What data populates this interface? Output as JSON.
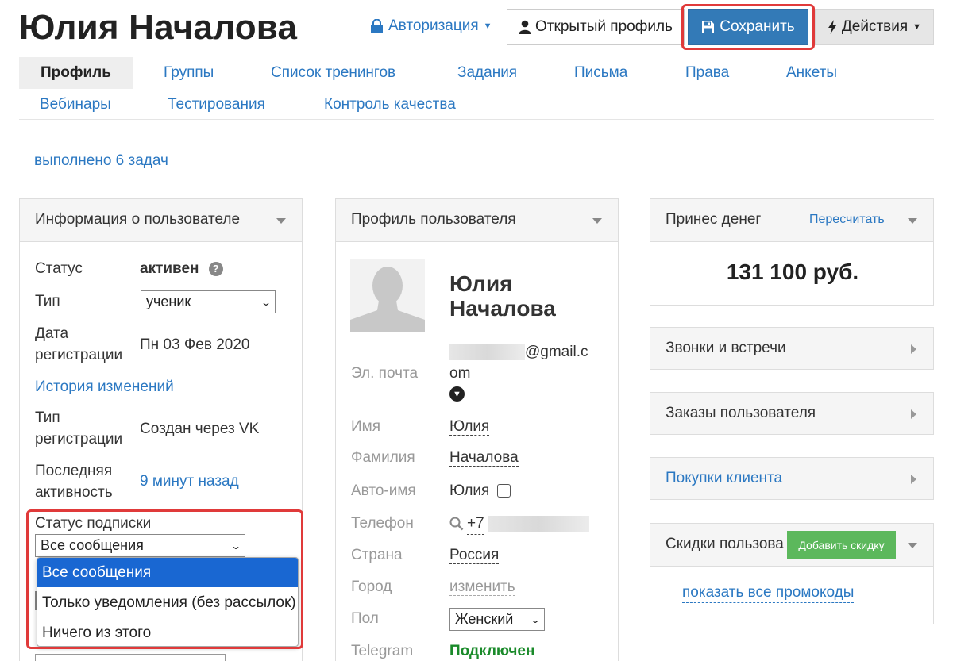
{
  "header": {
    "title": "Юлия Началова",
    "auth_label": "Авторизация",
    "open_profile_label": "Открытый профиль",
    "save_label": "Сохранить",
    "actions_label": "Действия"
  },
  "tabs": [
    {
      "label": "Профиль",
      "active": true
    },
    {
      "label": "Группы"
    },
    {
      "label": "Список тренингов"
    },
    {
      "label": "Задания"
    },
    {
      "label": "Письма"
    },
    {
      "label": "Права"
    },
    {
      "label": "Анкеты"
    },
    {
      "label": "Вебинары"
    },
    {
      "label": "Тестирования"
    },
    {
      "label": "Контроль качества"
    }
  ],
  "tasks_link": "выполнено 6 задач",
  "user_info": {
    "title": "Информация о пользователе",
    "status_label": "Статус",
    "status_value": "активен",
    "type_label": "Тип",
    "type_value": "ученик",
    "reg_date_label_1": "Дата",
    "reg_date_label_2": "регистрации",
    "reg_date_value": "Пн 03 Фев 2020",
    "history_link": "История изменений",
    "reg_type_label_1": "Тип",
    "reg_type_label_2": "регистрации",
    "reg_type_value": "Создан через VK",
    "last_activity_label_1": "Последняя",
    "last_activity_label_2": "активность",
    "last_activity_value": "9 минут назад",
    "subscription_label": "Статус подписки",
    "subscription_value": "Все сообщения",
    "subscription_options": [
      "Все сообщения",
      "Только уведомления (без рассылок)",
      "Ничего из этого"
    ]
  },
  "profile": {
    "title": "Профиль пользователя",
    "name_line1": "Юлия",
    "name_line2": "Началова",
    "email_visible_1": "@gmail.c",
    "email_visible_2": "om",
    "email_label": "Эл. почта",
    "first_name_label": "Имя",
    "first_name_value": "Юлия",
    "last_name_label": "Фамилия",
    "last_name_value": "Началова",
    "auto_name_label": "Авто-имя",
    "auto_name_value": "Юлия",
    "phone_label": "Телефон",
    "phone_prefix": "+7",
    "country_label": "Страна",
    "country_value": "Россия",
    "city_label": "Город",
    "city_value": "изменить",
    "gender_label": "Пол",
    "gender_value": "Женский",
    "telegram_label": "Telegram",
    "telegram_value": "Подключен"
  },
  "right": {
    "money_title": "Принес денег",
    "recalc_link": "Пересчитать",
    "money_value": "131 100 руб.",
    "calls_title": "Звонки и встречи",
    "orders_title": "Заказы пользователя",
    "purchases_title": "Покупки клиента",
    "discounts_title": "Скидки пользова",
    "add_discount_label": "Добавить скидку",
    "promo_link": "показать все промокоды"
  },
  "colors": {
    "link": "#2b78c2",
    "primary": "#337ab7",
    "highlight": "#e03a3a",
    "success": "#5cb85c",
    "telegram_ok": "#1a8a2a"
  }
}
